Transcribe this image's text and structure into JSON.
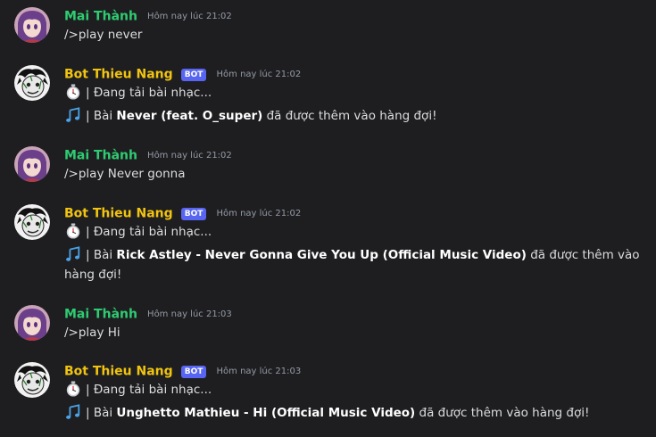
{
  "colors": {
    "user_name": "#2ecc71",
    "bot_name": "#f1c40f",
    "bot_tag_bg": "#5865f2",
    "background": "#1e1e21"
  },
  "messages": [
    {
      "author": "Mai Thành",
      "time": "Hôm nay lúc 21:02",
      "text": "/>play never"
    },
    {
      "author": "Bot Thieu Nang",
      "bot_tag": "BOT",
      "time": "Hôm nay lúc 21:02",
      "loading_icon": "stopwatch-icon",
      "loading_text": "| Đang tải bài nhạc...",
      "music_icon": "music-notes-icon",
      "added_prefix": "| Bài ",
      "song": "Never (feat. O_super)",
      "added_suffix": " đã được thêm vào hàng đợi!"
    },
    {
      "author": "Mai Thành",
      "time": "Hôm nay lúc 21:02",
      "text": "/>play Never gonna"
    },
    {
      "author": "Bot Thieu Nang",
      "bot_tag": "BOT",
      "time": "Hôm nay lúc 21:02",
      "loading_icon": "stopwatch-icon",
      "loading_text": "| Đang tải bài nhạc...",
      "music_icon": "music-notes-icon",
      "added_prefix": "| Bài ",
      "song": "Rick Astley - Never Gonna Give You Up (Official Music Video)",
      "added_suffix": " đã được thêm vào hàng đợi!"
    },
    {
      "author": "Mai Thành",
      "time": "Hôm nay lúc 21:03",
      "text": "/>play Hi"
    },
    {
      "author": "Bot Thieu Nang",
      "bot_tag": "BOT",
      "time": "Hôm nay lúc 21:03",
      "loading_icon": "stopwatch-icon",
      "loading_text": "| Đang tải bài nhạc...",
      "music_icon": "music-notes-icon",
      "added_prefix": "| Bài ",
      "song": "Unghetto Mathieu - Hi (Official Music Video)",
      "added_suffix": " đã được thêm vào hàng đợi!"
    }
  ]
}
